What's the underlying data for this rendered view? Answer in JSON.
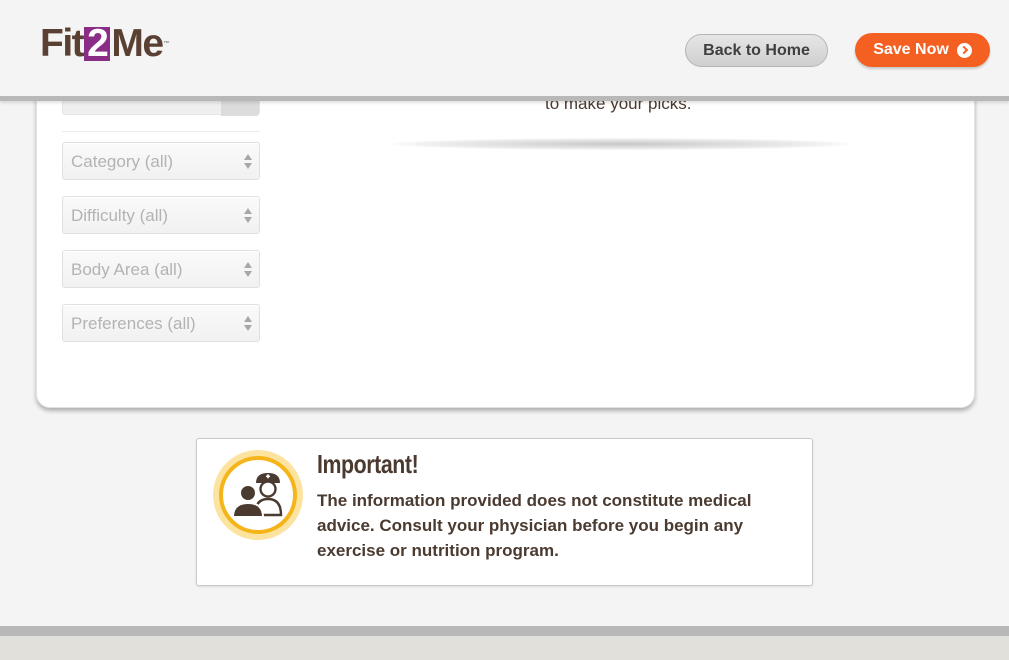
{
  "header": {
    "logo": {
      "fit": "Fit",
      "two": "2",
      "me": "Me",
      "tm": "™"
    },
    "back_home_label": "Back to Home",
    "save_now_label": "Save Now"
  },
  "filters": {
    "items": [
      {
        "label": "Category (all)"
      },
      {
        "label": "Difficulty (all)"
      },
      {
        "label": "Body Area (all)"
      },
      {
        "label": "Preferences (all)"
      }
    ]
  },
  "main": {
    "picks_text": "to make your picks."
  },
  "notice": {
    "title": "Important!",
    "body": "The information provided does not constitute medical advice. Consult your physician before you begin any exercise or nutrition program.",
    "icon": "doctor-nurse-icon"
  },
  "colors": {
    "brand_purple": "#8a2d86",
    "brand_brown": "#5a4032",
    "accent_orange": "#f36021",
    "notice_ring": "#f5b51a"
  }
}
